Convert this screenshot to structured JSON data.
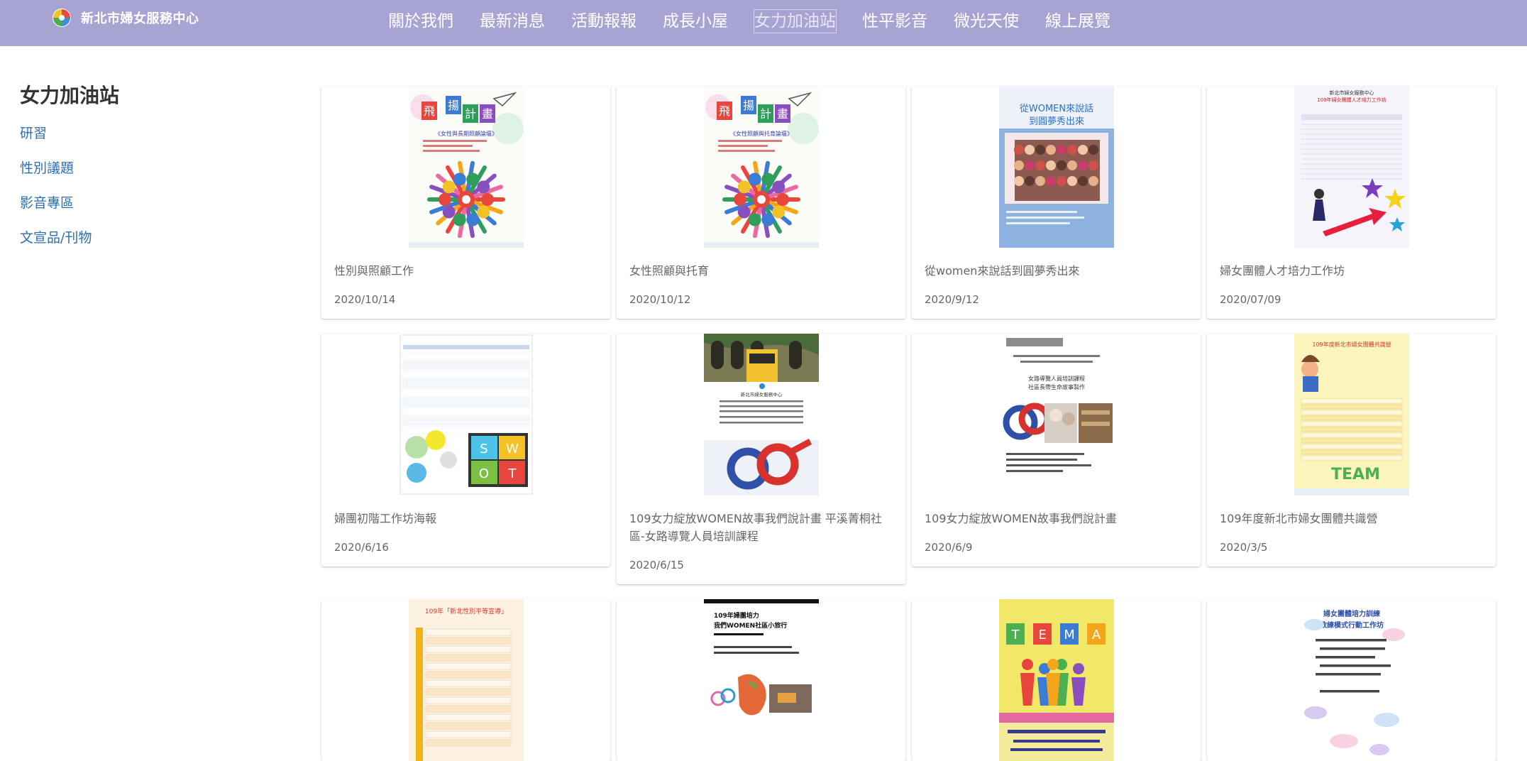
{
  "site": {
    "title": "新北市婦女服務中心"
  },
  "nav": [
    {
      "label": "關於我們",
      "active": false
    },
    {
      "label": "最新消息",
      "active": false
    },
    {
      "label": "活動報報",
      "active": false
    },
    {
      "label": "成長小屋",
      "active": false
    },
    {
      "label": "女力加油站",
      "active": true
    },
    {
      "label": "性平影音",
      "active": false
    },
    {
      "label": "微光天使",
      "active": false
    },
    {
      "label": "線上展覽",
      "active": false
    }
  ],
  "sidebar": {
    "title": "女力加油站",
    "items": [
      {
        "label": "研習"
      },
      {
        "label": "性別議題"
      },
      {
        "label": "影音專區"
      },
      {
        "label": "文宣品/刊物"
      }
    ]
  },
  "cards": [
    {
      "title": "性別與照顧工作",
      "date": "2020/10/14",
      "poster": "flyer",
      "poster_text": [
        "飛",
        "揚",
        "計",
        "畫",
        "《女性與長期照顧論壇》"
      ]
    },
    {
      "title": "女性照顧與托育",
      "date": "2020/10/12",
      "poster": "flyer",
      "poster_text": [
        "飛",
        "揚",
        "計",
        "畫",
        "《女性照顧與托育論壇》"
      ]
    },
    {
      "title": "從women來說話到圓夢秀出來",
      "date": "2020/9/12",
      "poster": "photo",
      "poster_text": [
        "從WOMEN來說話",
        "到圓夢秀出來"
      ]
    },
    {
      "title": "婦女團體人才培力工作坊",
      "date": "2020/07/09",
      "poster": "stars",
      "poster_text": [
        "新北市婦女服務中心",
        "109年婦女團體人才培力工作坊"
      ]
    },
    {
      "title": "婦團初階工作坊海報",
      "date": "2020/6/16",
      "poster": "swot",
      "poster_text": [
        "S",
        "W",
        "O",
        "T"
      ]
    },
    {
      "title": "109女力綻放WOMEN故事我們說計畫 平溪菁桐社區-女路導覽人員培訓課程",
      "date": "2020/6/15",
      "poster": "train",
      "poster_text": [
        "新北市婦女服務中心"
      ]
    },
    {
      "title": "109女力綻放WOMEN故事我們說計畫",
      "date": "2020/6/9",
      "poster": "gender",
      "poster_text": [
        "女路導覽人員培訓課程",
        "社區長帶生命故事製作"
      ]
    },
    {
      "title": "109年度新北市婦女團體共識營",
      "date": "2020/3/5",
      "poster": "team",
      "poster_text": [
        "109年度新北市婦女團體共識營",
        "TEAM"
      ]
    },
    {
      "title": "",
      "date": "",
      "poster": "orange",
      "poster_text": [
        "109年「新北性別平等宣導」"
      ]
    },
    {
      "title": "",
      "date": "",
      "poster": "bw",
      "poster_text": [
        "109年婦團培力",
        "我們WOMEN社區小旅行"
      ]
    },
    {
      "title": "",
      "date": "",
      "poster": "tema",
      "poster_text": [
        "T",
        "E",
        "M",
        "A"
      ]
    },
    {
      "title": "",
      "date": "",
      "poster": "clouds",
      "poster_text": [
        "婦女團體培力訓練",
        "教練模式行動工作坊"
      ]
    }
  ],
  "colors": {
    "header_bg": "#a7a3d3",
    "link": "#2d6fb0"
  }
}
